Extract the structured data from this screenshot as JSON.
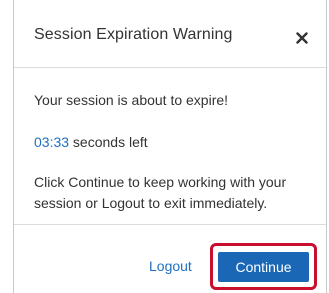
{
  "dialog": {
    "title": "Session Expiration Warning",
    "close_icon": "close-icon",
    "message": "Your session is about to expire!",
    "countdown": {
      "time": "03:33",
      "suffix": " seconds left"
    },
    "instructions": "Click Continue to keep working with your session or Logout to exit immediately.",
    "logout_label": "Logout",
    "continue_label": "Continue"
  },
  "colors": {
    "link": "#1f70c1",
    "primary_button": "#1a67b6",
    "highlight_outline": "#c8102e",
    "text": "#333333"
  }
}
